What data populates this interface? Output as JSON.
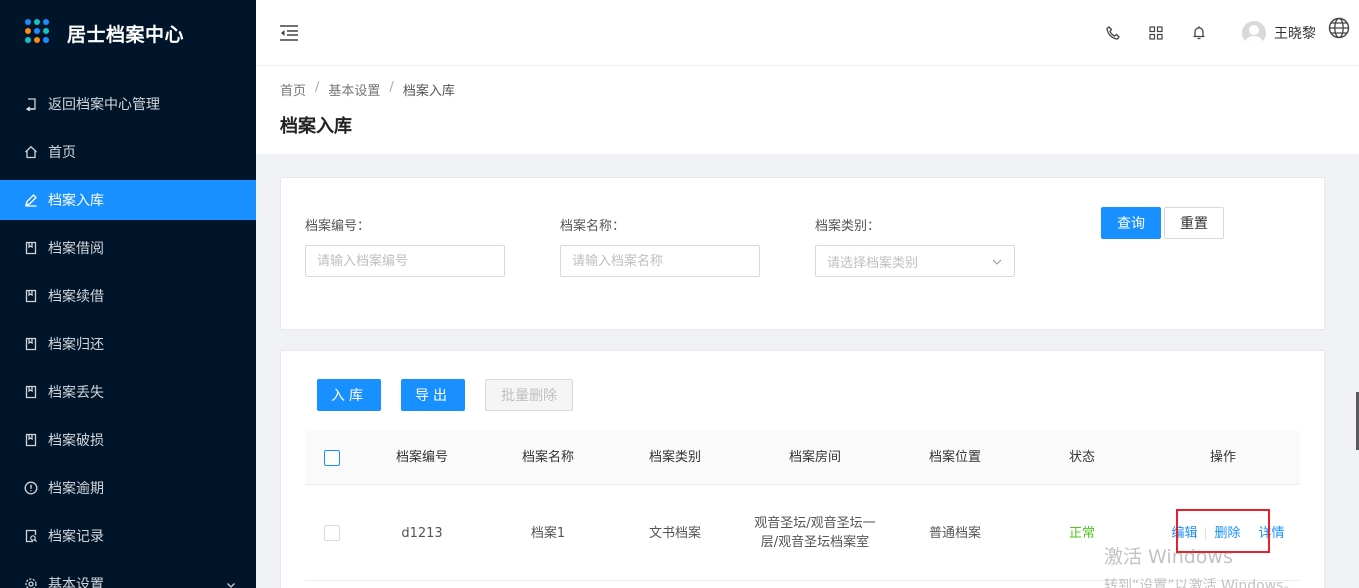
{
  "app": {
    "title": "居士档案中心"
  },
  "sidebar": {
    "items": [
      {
        "label": "返回档案中心管理",
        "icon": "return-icon"
      },
      {
        "label": "首页",
        "icon": "home-icon"
      },
      {
        "label": "档案入库",
        "icon": "edit-icon",
        "active": true
      },
      {
        "label": "档案借阅",
        "icon": "file-icon"
      },
      {
        "label": "档案续借",
        "icon": "file-icon"
      },
      {
        "label": "档案归还",
        "icon": "file-icon"
      },
      {
        "label": "档案丢失",
        "icon": "file-icon"
      },
      {
        "label": "档案破损",
        "icon": "file-icon"
      },
      {
        "label": "档案逾期",
        "icon": "alert-circle-icon"
      },
      {
        "label": "档案记录",
        "icon": "file-search-icon"
      },
      {
        "label": "基本设置",
        "icon": "gear-icon"
      }
    ],
    "colors": {
      "background": "#001529",
      "active": "#1890ff"
    }
  },
  "header": {
    "user_name": "王晓黎",
    "icons": [
      "phone-icon",
      "grid-icon",
      "bell-icon",
      "avatar",
      "globe-icon"
    ]
  },
  "breadcrumb": {
    "items": [
      "首页",
      "基本设置",
      "档案入库"
    ],
    "separator": "/"
  },
  "page": {
    "title": "档案入库"
  },
  "search": {
    "fields": [
      {
        "label": "档案编号：",
        "placeholder": "请输入档案编号"
      },
      {
        "label": "档案名称：",
        "placeholder": "请输入档案名称"
      },
      {
        "label": "档案类别：",
        "placeholder": "请选择档案类别"
      }
    ],
    "query_label": "查询",
    "reset_label": "重置"
  },
  "toolbar": {
    "import_label": "入库",
    "export_label": "导出",
    "batch_delete_label": "批量删除"
  },
  "table": {
    "columns": [
      "档案编号",
      "档案名称",
      "档案类别",
      "档案房间",
      "档案位置",
      "状态",
      "操作"
    ],
    "rows": [
      {
        "code": "d1213",
        "name": "档案1",
        "category": "文书档案",
        "room": "观音圣坛/观音圣坛一层/观音圣坛档案室",
        "location": "普通档案",
        "status": "正常",
        "status_color": "#52c41a",
        "actions": {
          "edit": "编辑",
          "delete": "删除",
          "detail": "详情"
        }
      }
    ]
  },
  "watermark": {
    "line1": "激活 Windows",
    "line2": "转到“设置”以激活 Windows。"
  }
}
